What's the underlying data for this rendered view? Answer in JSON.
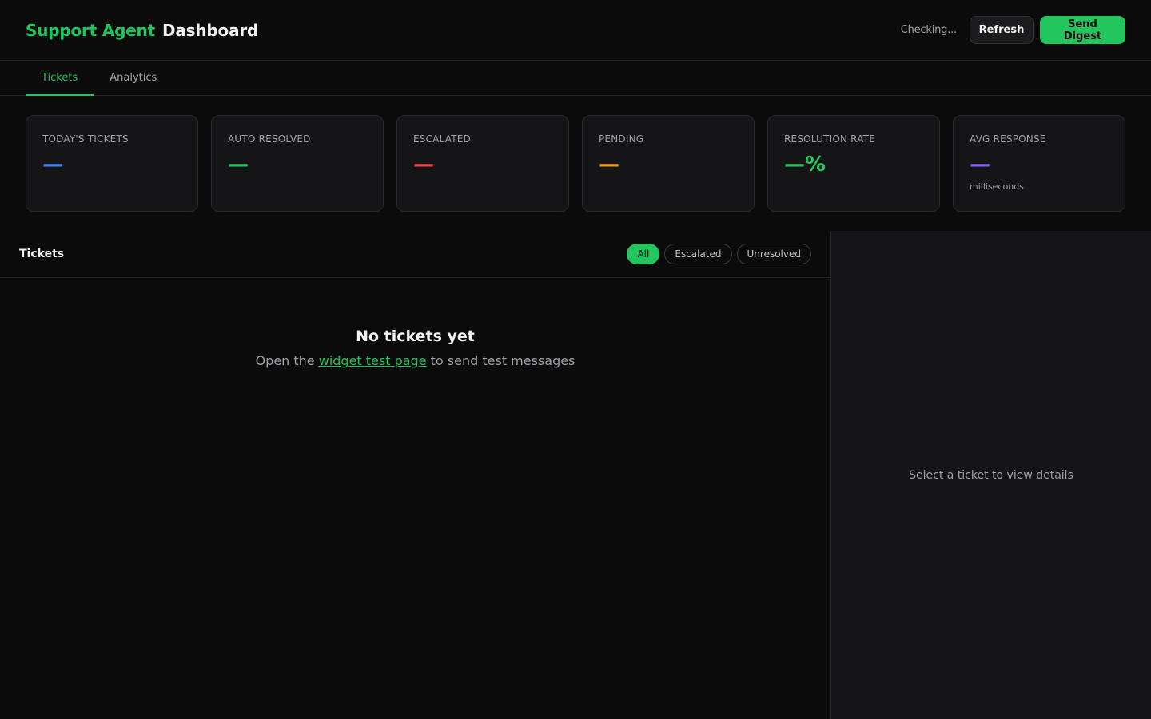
{
  "header": {
    "brand_accent": "Support Agent",
    "brand_main": "Dashboard",
    "status": "Checking...",
    "refresh_label": "Refresh",
    "digest_label": "Send Digest"
  },
  "tabs": [
    {
      "label": "Tickets",
      "active": true
    },
    {
      "label": "Analytics",
      "active": false
    }
  ],
  "stats": [
    {
      "label": "Today's Tickets",
      "value": "—",
      "color": "#3b82f6",
      "sub": ""
    },
    {
      "label": "Auto Resolved",
      "value": "—",
      "color": "#22c55e",
      "sub": ""
    },
    {
      "label": "Escalated",
      "value": "—",
      "color": "#ef4444",
      "sub": ""
    },
    {
      "label": "Pending",
      "value": "—",
      "color": "#f59e0b",
      "sub": ""
    },
    {
      "label": "Resolution Rate",
      "value": "—%",
      "color": "#22c55e",
      "sub": ""
    },
    {
      "label": "Avg Response",
      "value": "—",
      "color": "#8b5cf6",
      "sub": "milliseconds"
    }
  ],
  "tickets": {
    "title": "Tickets",
    "filters": [
      {
        "label": "All",
        "active": true
      },
      {
        "label": "Escalated",
        "active": false
      },
      {
        "label": "Unresolved",
        "active": false
      }
    ],
    "empty_title": "No tickets yet",
    "empty_prefix": "Open the ",
    "empty_link": "widget test page",
    "empty_suffix": " to send test messages"
  },
  "detail": {
    "placeholder": "Select a ticket to view details"
  },
  "colors": {
    "accent": "#22c55e",
    "background": "#0b0b0c",
    "panel": "#151518"
  }
}
